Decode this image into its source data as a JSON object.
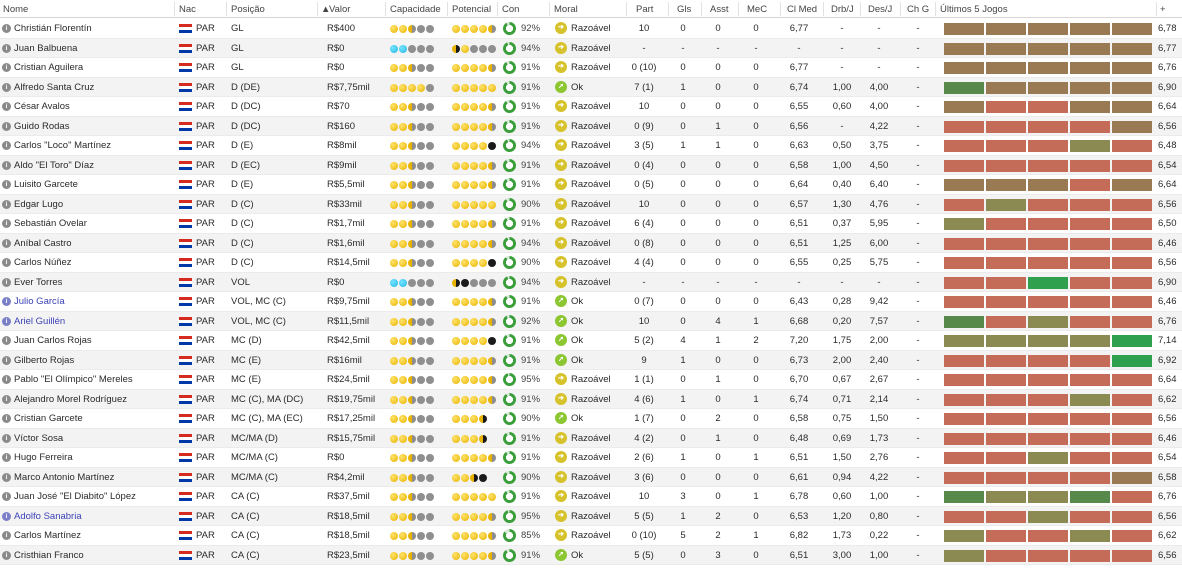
{
  "headers": {
    "name": "Nome",
    "nat": "Nac",
    "pos": "Posição",
    "value": "Valor",
    "cap": "Capacidade",
    "pot": "Potencial",
    "cond": "Con",
    "moral": "Moral",
    "part": "Part",
    "gls": "Gls",
    "asst": "Asst",
    "mec": "MeC",
    "clmed": "Cl Med",
    "drb": "Drb/J",
    "des": "Des/J",
    "chg": "Ch G",
    "form": "Últimos 5 Jogos",
    "add": "+"
  },
  "colors": {
    "form_avg": "#9a7a52",
    "form_poor": "#c56c58",
    "form_ok": "#8a8a52",
    "form_good": "#56894a",
    "form_great": "#2ea04e",
    "cond_ring": "#3a9f3a",
    "cond_ring_empty": "#d8e8d8"
  },
  "players": [
    {
      "name": "Christián Florentín",
      "loan": false,
      "nat": "PAR",
      "pos": "GL",
      "value": "R$400",
      "cap": "ffhee",
      "pot": "ffffh",
      "cond": "92%",
      "cond_level": 0.92,
      "moral": "Razoável",
      "moral_state": "okay",
      "part": "10",
      "gls": "0",
      "asst": "0",
      "mec": "0",
      "clmed": "6,77",
      "drb": "-",
      "des": "-",
      "chg": "-",
      "form": [
        "avg",
        "avg",
        "avg",
        "avg",
        "avg"
      ],
      "avg": "6,78"
    },
    {
      "name": "Juan Balbuena",
      "loan": false,
      "nat": "PAR",
      "pos": "GL",
      "value": "R$0",
      "cap": "bbeee",
      "pot": "hkfeee",
      "cond": "94%",
      "cond_level": 0.94,
      "moral": "Razoável",
      "moral_state": "okay",
      "part": "-",
      "gls": "-",
      "asst": "-",
      "mec": "-",
      "clmed": "-",
      "drb": "-",
      "des": "-",
      "chg": "-",
      "form": [
        "avg",
        "avg",
        "avg",
        "avg",
        "avg"
      ],
      "avg": "6,77"
    },
    {
      "name": "Cristian Aguilera",
      "loan": false,
      "nat": "PAR",
      "pos": "GL",
      "value": "R$0",
      "cap": "ffhee",
      "pot": "ffffh",
      "cond": "91%",
      "cond_level": 0.91,
      "moral": "Razoável",
      "moral_state": "okay",
      "part": "0 (10)",
      "gls": "0",
      "asst": "0",
      "mec": "0",
      "clmed": "6,77",
      "drb": "-",
      "des": "-",
      "chg": "-",
      "form": [
        "avg",
        "avg",
        "avg",
        "avg",
        "avg"
      ],
      "avg": "6,76"
    },
    {
      "name": "Alfredo Santa Cruz",
      "loan": false,
      "nat": "PAR",
      "pos": "D (DE)",
      "value": "R$7,75mil",
      "cap": "ffffe",
      "pot": "fffff",
      "cond": "91%",
      "cond_level": 0.91,
      "moral": "Ok",
      "moral_state": "good",
      "part": "7 (1)",
      "gls": "1",
      "asst": "0",
      "mec": "0",
      "clmed": "6,74",
      "drb": "1,00",
      "des": "4,00",
      "chg": "-",
      "form": [
        "good",
        "avg",
        "avg",
        "avg",
        "avg"
      ],
      "avg": "6,90"
    },
    {
      "name": "César Avalos",
      "loan": false,
      "nat": "PAR",
      "pos": "D (DC)",
      "value": "R$70",
      "cap": "ffhee",
      "pot": "ffffh",
      "cond": "91%",
      "cond_level": 0.91,
      "moral": "Razoável",
      "moral_state": "okay",
      "part": "10",
      "gls": "0",
      "asst": "0",
      "mec": "0",
      "clmed": "6,55",
      "drb": "0,60",
      "des": "4,00",
      "chg": "-",
      "form": [
        "avg",
        "poor",
        "poor",
        "avg",
        "avg"
      ],
      "avg": "6,64"
    },
    {
      "name": "Guido Rodas",
      "loan": false,
      "nat": "PAR",
      "pos": "D (DC)",
      "value": "R$160",
      "cap": "ffhee",
      "pot": "ffffh",
      "cond": "91%",
      "cond_level": 0.91,
      "moral": "Razoável",
      "moral_state": "okay",
      "part": "0 (9)",
      "gls": "0",
      "asst": "1",
      "mec": "0",
      "clmed": "6,56",
      "drb": "-",
      "des": "4,22",
      "chg": "-",
      "form": [
        "poor",
        "poor",
        "poor",
        "poor",
        "avg"
      ],
      "avg": "6,56"
    },
    {
      "name": "Carlos \"Loco\" Martínez",
      "loan": false,
      "nat": "PAR",
      "pos": "D (E)",
      "value": "R$8mil",
      "cap": "ffhee",
      "pot": "ffffk",
      "cond": "94%",
      "cond_level": 0.94,
      "moral": "Razoável",
      "moral_state": "okay",
      "part": "3 (5)",
      "gls": "1",
      "asst": "1",
      "mec": "0",
      "clmed": "6,63",
      "drb": "0,50",
      "des": "3,75",
      "chg": "-",
      "form": [
        "poor",
        "poor",
        "poor",
        "ok",
        "poor"
      ],
      "avg": "6,48"
    },
    {
      "name": "Aldo \"El Toro\" Díaz",
      "loan": false,
      "nat": "PAR",
      "pos": "D (EC)",
      "value": "R$9mil",
      "cap": "ffhee",
      "pot": "ffffh",
      "cond": "91%",
      "cond_level": 0.91,
      "moral": "Razoável",
      "moral_state": "okay",
      "part": "0 (4)",
      "gls": "0",
      "asst": "0",
      "mec": "0",
      "clmed": "6,58",
      "drb": "1,00",
      "des": "4,50",
      "chg": "-",
      "form": [
        "poor",
        "poor",
        "poor",
        "poor",
        "poor"
      ],
      "avg": "6,54"
    },
    {
      "name": "Luisito Garcete",
      "loan": false,
      "nat": "PAR",
      "pos": "D (E)",
      "value": "R$5,5mil",
      "cap": "ffhee",
      "pot": "ffffh",
      "cond": "91%",
      "cond_level": 0.91,
      "moral": "Razoável",
      "moral_state": "okay",
      "part": "0 (5)",
      "gls": "0",
      "asst": "0",
      "mec": "0",
      "clmed": "6,64",
      "drb": "0,40",
      "des": "6,40",
      "chg": "-",
      "form": [
        "avg",
        "avg",
        "avg",
        "poor",
        "avg"
      ],
      "avg": "6,64"
    },
    {
      "name": "Edgar Lugo",
      "loan": false,
      "nat": "PAR",
      "pos": "D (C)",
      "value": "R$33mil",
      "cap": "ffhee",
      "pot": "fffff",
      "cond": "90%",
      "cond_level": 0.9,
      "moral": "Razoável",
      "moral_state": "okay",
      "part": "10",
      "gls": "0",
      "asst": "0",
      "mec": "0",
      "clmed": "6,57",
      "drb": "1,30",
      "des": "4,76",
      "chg": "-",
      "form": [
        "poor",
        "ok",
        "poor",
        "poor",
        "poor"
      ],
      "avg": "6,56"
    },
    {
      "name": "Sebastián Ovelar",
      "loan": false,
      "nat": "PAR",
      "pos": "D (C)",
      "value": "R$1,7mil",
      "cap": "ffhee",
      "pot": "ffffh",
      "cond": "91%",
      "cond_level": 0.91,
      "moral": "Razoável",
      "moral_state": "okay",
      "part": "6 (4)",
      "gls": "0",
      "asst": "0",
      "mec": "0",
      "clmed": "6,51",
      "drb": "0,37",
      "des": "5,95",
      "chg": "-",
      "form": [
        "ok",
        "poor",
        "poor",
        "poor",
        "poor"
      ],
      "avg": "6,50"
    },
    {
      "name": "Aníbal Castro",
      "loan": false,
      "nat": "PAR",
      "pos": "D (C)",
      "value": "R$1,6mil",
      "cap": "ffhee",
      "pot": "ffffh",
      "cond": "94%",
      "cond_level": 0.94,
      "moral": "Razoável",
      "moral_state": "okay",
      "part": "0 (8)",
      "gls": "0",
      "asst": "0",
      "mec": "0",
      "clmed": "6,51",
      "drb": "1,25",
      "des": "6,00",
      "chg": "-",
      "form": [
        "poor",
        "poor",
        "poor",
        "poor",
        "poor"
      ],
      "avg": "6,46"
    },
    {
      "name": "Carlos Núñez",
      "loan": false,
      "nat": "PAR",
      "pos": "D (C)",
      "value": "R$14,5mil",
      "cap": "ffhee",
      "pot": "ffffk",
      "cond": "90%",
      "cond_level": 0.9,
      "moral": "Razoável",
      "moral_state": "okay",
      "part": "4 (4)",
      "gls": "0",
      "asst": "0",
      "mec": "0",
      "clmed": "6,55",
      "drb": "0,25",
      "des": "5,75",
      "chg": "-",
      "form": [
        "poor",
        "poor",
        "poor",
        "poor",
        "poor"
      ],
      "avg": "6,56"
    },
    {
      "name": "Ever Torres",
      "loan": false,
      "nat": "PAR",
      "pos": "VOL",
      "value": "R$0",
      "cap": "bbeee",
      "pot": "hkkeee",
      "cond": "94%",
      "cond_level": 0.94,
      "moral": "Razoável",
      "moral_state": "okay",
      "part": "-",
      "gls": "-",
      "asst": "-",
      "mec": "-",
      "clmed": "-",
      "drb": "-",
      "des": "-",
      "chg": "-",
      "form": [
        "poor",
        "poor",
        "great",
        "poor",
        "poor"
      ],
      "avg": "6,90"
    },
    {
      "name": "Julio García",
      "loan": true,
      "nat": "PAR",
      "pos": "VOL, MC (C)",
      "value": "R$9,75mil",
      "cap": "ffhee",
      "pot": "ffffh",
      "cond": "91%",
      "cond_level": 0.91,
      "moral": "Ok",
      "moral_state": "good",
      "part": "0 (7)",
      "gls": "0",
      "asst": "0",
      "mec": "0",
      "clmed": "6,43",
      "drb": "0,28",
      "des": "9,42",
      "chg": "-",
      "form": [
        "poor",
        "poor",
        "poor",
        "poor",
        "poor"
      ],
      "avg": "6,46"
    },
    {
      "name": "Ariel Guillén",
      "loan": true,
      "nat": "PAR",
      "pos": "VOL, MC (C)",
      "value": "R$11,5mil",
      "cap": "ffhee",
      "pot": "ffffh",
      "cond": "92%",
      "cond_level": 0.92,
      "moral": "Ok",
      "moral_state": "good",
      "part": "10",
      "gls": "0",
      "asst": "4",
      "mec": "1",
      "clmed": "6,68",
      "drb": "0,20",
      "des": "7,57",
      "chg": "-",
      "form": [
        "good",
        "poor",
        "ok",
        "poor",
        "poor"
      ],
      "avg": "6,76"
    },
    {
      "name": "Juan Carlos Rojas",
      "loan": false,
      "nat": "PAR",
      "pos": "MC (D)",
      "value": "R$42,5mil",
      "cap": "ffhee",
      "pot": "ffffk",
      "cond": "91%",
      "cond_level": 0.91,
      "moral": "Ok",
      "moral_state": "good",
      "part": "5 (2)",
      "gls": "4",
      "asst": "1",
      "mec": "2",
      "clmed": "7,20",
      "drb": "1,75",
      "des": "2,00",
      "chg": "-",
      "form": [
        "ok",
        "ok",
        "ok",
        "ok",
        "great"
      ],
      "avg": "7,14"
    },
    {
      "name": "Gilberto Rojas",
      "loan": false,
      "nat": "PAR",
      "pos": "MC (E)",
      "value": "R$16mil",
      "cap": "ffhee",
      "pot": "ffffh",
      "cond": "91%",
      "cond_level": 0.91,
      "moral": "Ok",
      "moral_state": "good",
      "part": "9",
      "gls": "1",
      "asst": "0",
      "mec": "0",
      "clmed": "6,73",
      "drb": "2,00",
      "des": "2,40",
      "chg": "-",
      "form": [
        "poor",
        "poor",
        "poor",
        "poor",
        "great"
      ],
      "avg": "6,92"
    },
    {
      "name": "Pablo \"El Olímpico\" Mereles",
      "loan": false,
      "nat": "PAR",
      "pos": "MC (E)",
      "value": "R$24,5mil",
      "cap": "ffhee",
      "pot": "ffffh",
      "cond": "95%",
      "cond_level": 0.95,
      "moral": "Razoável",
      "moral_state": "okay",
      "part": "1 (1)",
      "gls": "0",
      "asst": "1",
      "mec": "0",
      "clmed": "6,70",
      "drb": "0,67",
      "des": "2,67",
      "chg": "-",
      "form": [
        "poor",
        "poor",
        "poor",
        "poor",
        "poor"
      ],
      "avg": "6,64"
    },
    {
      "name": "Alejandro Morel Rodríguez",
      "loan": false,
      "nat": "PAR",
      "pos": "MC (C), MA (DC)",
      "value": "R$19,75mil",
      "cap": "ffhee",
      "pot": "ffffh",
      "cond": "91%",
      "cond_level": 0.91,
      "moral": "Razoável",
      "moral_state": "okay",
      "part": "4 (6)",
      "gls": "1",
      "asst": "0",
      "mec": "1",
      "clmed": "6,74",
      "drb": "0,71",
      "des": "2,14",
      "chg": "-",
      "form": [
        "poor",
        "poor",
        "poor",
        "ok",
        "poor"
      ],
      "avg": "6,62"
    },
    {
      "name": "Cristian Garcete",
      "loan": false,
      "nat": "PAR",
      "pos": "MC (C), MA (EC)",
      "value": "R$17,25mil",
      "cap": "ffhee",
      "pot": "fffhk",
      "cond": "90%",
      "cond_level": 0.9,
      "moral": "Ok",
      "moral_state": "good",
      "part": "1 (7)",
      "gls": "0",
      "asst": "2",
      "mec": "0",
      "clmed": "6,58",
      "drb": "0,75",
      "des": "1,50",
      "chg": "-",
      "form": [
        "poor",
        "poor",
        "poor",
        "poor",
        "poor"
      ],
      "avg": "6,56"
    },
    {
      "name": "Víctor Sosa",
      "loan": false,
      "nat": "PAR",
      "pos": "MC/MA (D)",
      "value": "R$15,75mil",
      "cap": "ffhee",
      "pot": "fffhk",
      "cond": "91%",
      "cond_level": 0.91,
      "moral": "Razoável",
      "moral_state": "okay",
      "part": "4 (2)",
      "gls": "0",
      "asst": "1",
      "mec": "0",
      "clmed": "6,48",
      "drb": "0,69",
      "des": "1,73",
      "chg": "-",
      "form": [
        "poor",
        "poor",
        "poor",
        "poor",
        "poor"
      ],
      "avg": "6,46"
    },
    {
      "name": "Hugo Ferreira",
      "loan": false,
      "nat": "PAR",
      "pos": "MC/MA (C)",
      "value": "R$0",
      "cap": "ffhee",
      "pot": "ffffh",
      "cond": "91%",
      "cond_level": 0.91,
      "moral": "Razoável",
      "moral_state": "okay",
      "part": "2 (6)",
      "gls": "1",
      "asst": "0",
      "mec": "1",
      "clmed": "6,51",
      "drb": "1,50",
      "des": "2,76",
      "chg": "-",
      "form": [
        "poor",
        "poor",
        "ok",
        "poor",
        "poor"
      ],
      "avg": "6,54"
    },
    {
      "name": "Marco Antonio Martínez",
      "loan": false,
      "nat": "PAR",
      "pos": "MC/MA (C)",
      "value": "R$4,2mil",
      "cap": "ffhee",
      "pot": "ffhkk",
      "cond": "90%",
      "cond_level": 0.9,
      "moral": "Razoável",
      "moral_state": "okay",
      "part": "3 (6)",
      "gls": "0",
      "asst": "0",
      "mec": "0",
      "clmed": "6,61",
      "drb": "0,94",
      "des": "4,22",
      "chg": "-",
      "form": [
        "poor",
        "poor",
        "poor",
        "poor",
        "avg"
      ],
      "avg": "6,58"
    },
    {
      "name": "Juan José \"El Diabito\" López",
      "loan": false,
      "nat": "PAR",
      "pos": "CA (C)",
      "value": "R$37,5mil",
      "cap": "ffhee",
      "pot": "fffff",
      "cond": "91%",
      "cond_level": 0.91,
      "moral": "Razoável",
      "moral_state": "okay",
      "part": "10",
      "gls": "3",
      "asst": "0",
      "mec": "1",
      "clmed": "6,78",
      "drb": "0,60",
      "des": "1,00",
      "chg": "-",
      "form": [
        "good",
        "ok",
        "ok",
        "good",
        "poor"
      ],
      "avg": "6,76"
    },
    {
      "name": "Adolfo Sanabria",
      "loan": true,
      "nat": "PAR",
      "pos": "CA (C)",
      "value": "R$18,5mil",
      "cap": "ffhee",
      "pot": "ffffh",
      "cond": "95%",
      "cond_level": 0.95,
      "moral": "Razoável",
      "moral_state": "okay",
      "part": "5 (5)",
      "gls": "1",
      "asst": "2",
      "mec": "0",
      "clmed": "6,53",
      "drb": "1,20",
      "des": "0,80",
      "chg": "-",
      "form": [
        "poor",
        "poor",
        "ok",
        "poor",
        "poor"
      ],
      "avg": "6,56"
    },
    {
      "name": "Carlos Martínez",
      "loan": false,
      "nat": "PAR",
      "pos": "CA (C)",
      "value": "R$18,5mil",
      "cap": "ffhee",
      "pot": "ffffh",
      "cond": "85%",
      "cond_level": 0.85,
      "moral": "Razoável",
      "moral_state": "okay",
      "part": "0 (10)",
      "gls": "5",
      "asst": "2",
      "mec": "1",
      "clmed": "6,82",
      "drb": "1,73",
      "des": "0,22",
      "chg": "-",
      "form": [
        "ok",
        "poor",
        "poor",
        "ok",
        "poor"
      ],
      "avg": "6,62"
    },
    {
      "name": "Cristhian Franco",
      "loan": false,
      "nat": "PAR",
      "pos": "CA (C)",
      "value": "R$23,5mil",
      "cap": "ffhee",
      "pot": "ffffh",
      "cond": "91%",
      "cond_level": 0.91,
      "moral": "Ok",
      "moral_state": "good",
      "part": "5 (5)",
      "gls": "0",
      "asst": "3",
      "mec": "0",
      "clmed": "6,51",
      "drb": "3,00",
      "des": "1,00",
      "chg": "-",
      "form": [
        "ok",
        "poor",
        "poor",
        "poor",
        "poor"
      ],
      "avg": "6,56"
    }
  ]
}
